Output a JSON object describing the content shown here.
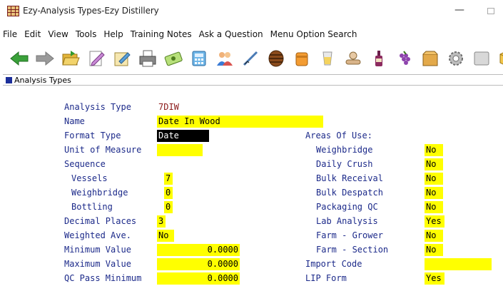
{
  "window": {
    "title": "Ezy-Analysis Types-Ezy Distillery",
    "minimize_glyph": "—"
  },
  "menu": [
    "File",
    "Edit",
    "View",
    "Tools",
    "Help",
    "Training Notes",
    "Ask a Question",
    "Menu Option Search"
  ],
  "toolbar_icons": [
    "back-arrow-icon",
    "forward-arrow-icon",
    "open-folder-icon",
    "edit-document-icon",
    "pen-document-icon",
    "printer-icon",
    "money-icon",
    "calculator-icon",
    "users-icon",
    "ruler-icon",
    "barrel-icon",
    "tank-icon",
    "drink-icon",
    "hand-icon",
    "bottle-icon",
    "grapes-icon",
    "box-icon",
    "gear-icon",
    "panel-icon",
    "cube-icon",
    "vine-icon",
    "leaf-icon"
  ],
  "module": {
    "title": "Analysis Types"
  },
  "form": {
    "analysis_type_label": "Analysis Type",
    "analysis_type_value": "7DIW",
    "name_label": "Name",
    "name_value": "Date In Wood",
    "format_type_label": "Format Type",
    "format_type_value": "Date",
    "unit_label": "Unit of Measure",
    "unit_value": "",
    "sequence_label": "Sequence",
    "vessels_label": "Vessels",
    "vessels_value": "7",
    "weighbridge_seq_label": "Weighbridge",
    "weighbridge_seq_value": "0",
    "bottling_label": "Bottling",
    "bottling_value": "0",
    "decimal_label": "Decimal Places",
    "decimal_value": "3",
    "weighted_label": "Weighted Ave.",
    "weighted_value": "No",
    "min_label": "Minimum Value",
    "min_value": "0.0000",
    "max_label": "Maximum Value",
    "max_value": "0.0000",
    "qc_label": "QC Pass Minimum",
    "qc_value": "0.0000",
    "areas_label": "Areas Of Use:",
    "areas": [
      {
        "label": "Weighbridge",
        "value": "No"
      },
      {
        "label": "Daily Crush",
        "value": "No"
      },
      {
        "label": "Bulk Receival",
        "value": "No"
      },
      {
        "label": "Bulk Despatch",
        "value": "No"
      },
      {
        "label": "Packaging QC",
        "value": "No"
      },
      {
        "label": "Lab Analysis",
        "value": "Yes"
      },
      {
        "label": "Farm - Grower",
        "value": "No"
      },
      {
        "label": "Farm - Section",
        "value": "No"
      }
    ],
    "import_code_label": "Import Code",
    "import_code_value": "",
    "lip_label": "LIP Form",
    "lip_value": "Yes"
  }
}
